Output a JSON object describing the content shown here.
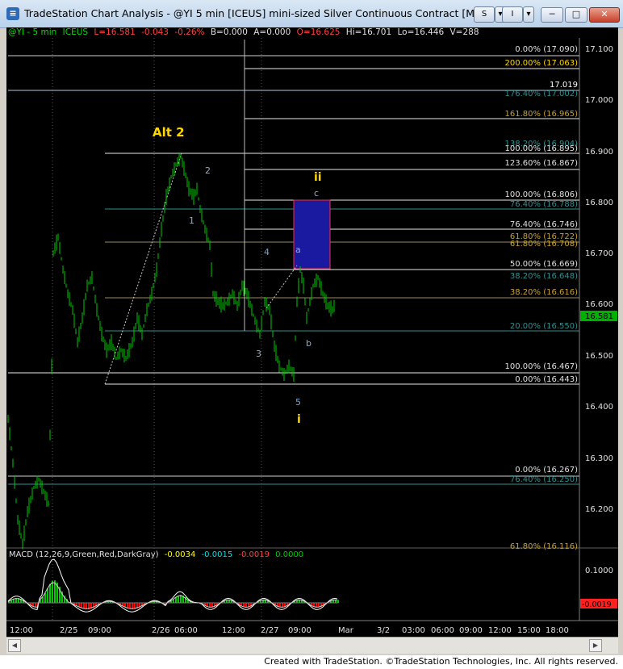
{
  "window": {
    "title": "TradeStation Chart Analysis - @YI 5 min [ICEUS] mini-sized Silver Continuous Contract [May15]",
    "buttons": {
      "s": "S",
      "i": "I",
      "dropdown": "▾",
      "minimize": "─",
      "maximize": "□",
      "close": "✕"
    }
  },
  "status": {
    "symbol": "@YI - 5 min",
    "exchange": "ICEUS",
    "last": "L=16.581",
    "net": "-0.043",
    "pct": "-0.26%",
    "bid": "B=0.000",
    "ask": "A=0.000",
    "open": "O=16.625",
    "high": "Hi=16.701",
    "low": "Lo=16.446",
    "volume": "V=288"
  },
  "price_axis": {
    "ticks": [
      "17.100",
      "17.000",
      "16.900",
      "16.800",
      "16.700",
      "16.600",
      "16.500",
      "16.400",
      "16.300",
      "16.200"
    ],
    "last_price_label": "16.581"
  },
  "fib_labels": [
    "0.00% (17.090)",
    "200.00% (17.063)",
    "17.019",
    "176.40% (17.002)",
    "161.80% (16.965)",
    "138.20% (16.904)",
    "100.00% (16.895)",
    "123.60% (16.867)",
    "100.00% (16.806)",
    "76.40% (16.788)",
    "76.40% (16.746)",
    "61.80% (16.722)",
    "61.80% (16.708)",
    "50.00% (16.669)",
    "38.20% (16.648)",
    "38.20% (16.616)",
    "20.00% (16.550)",
    "100.00% (16.467)",
    "0.00% (16.443)",
    "0.00% (16.267)",
    "76.40% (16.250)",
    "61.80% (16.116)"
  ],
  "wave_labels": {
    "alt2": "Alt 2",
    "w1": "1",
    "w2": "2",
    "w3": "3",
    "w4": "4",
    "w5": "5",
    "wi": "i",
    "wii": "ii",
    "wa": "a",
    "wb": "b",
    "wc": "c"
  },
  "macd": {
    "title": "MACD (12,26,9,Green,Red,DarkGray)",
    "macd": "-0.0034",
    "signal": "-0.0015",
    "diff": "-0.0019",
    "zero": "0.0000",
    "axis_tick": "0.1000",
    "last_label": "-0.0019"
  },
  "time_axis": [
    "12:00",
    "2/25",
    "09:00",
    "2/26",
    "06:00",
    "12:00",
    "2/27",
    "09:00",
    "Mar",
    "3/2",
    "03:00",
    "06:00",
    "09:00",
    "12:00",
    "15:00",
    "18:00"
  ],
  "footer": "Created with TradeStation. ©TradeStation Technologies, Inc. All rights reserved.",
  "colors": {
    "up": "#00cc00",
    "macd_up": "#00cc00",
    "macd_down": "#ff0000",
    "gold": "#ffd700",
    "box": "#1a1aa0"
  }
}
